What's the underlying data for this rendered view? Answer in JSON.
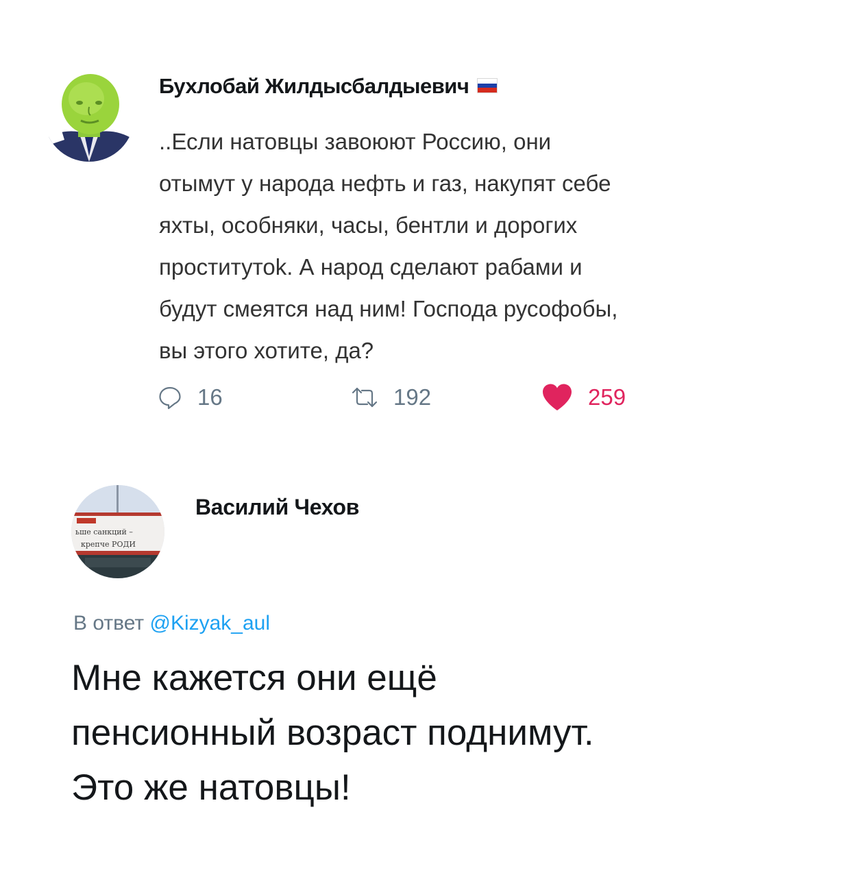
{
  "colors": {
    "text": "#14171a",
    "secondary": "#657786",
    "link": "#1da1f2",
    "like": "#e0245e"
  },
  "tweet": {
    "author": "Бухлобай Жилдысбалдыевич",
    "author_flag_icon": "russia-flag-icon",
    "avatar_icon": "avatar-green-face",
    "text": "..Если натовцы  завоюют Россию, они\nотымут у народа нефть и газ, накупят себе\nяхты, особняки, часы, бентли и дорогих\nпроститутоk. А народ сделают рабами и\nбудут смеятся над ним! Господа русофобы,\nвы этого хотите, да?",
    "stats": {
      "replies": "16",
      "retweets": "192",
      "likes": "259"
    },
    "icons": {
      "reply": "reply-bubble-icon",
      "retweet": "retweet-icon",
      "like": "heart-filled-icon"
    }
  },
  "reply": {
    "author": "Василий Чехов",
    "avatar_icon": "avatar-billboard",
    "avatar_text_1": "ьше санкций –",
    "avatar_text_2": "крепче РОДИ",
    "reply_prefix": "В ответ ",
    "reply_mention": "@Kizyak_aul",
    "text": "Мне кажется они ещё\nпенсионный возраст поднимут.\nЭто же натовцы!"
  }
}
